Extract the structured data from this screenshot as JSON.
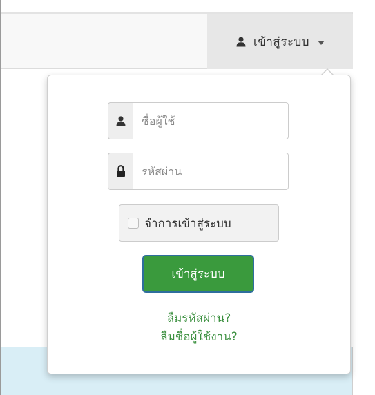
{
  "navbar": {
    "login_toggle_label": "เข้าสู่ระบบ",
    "login_toggle_icon": "user-icon",
    "caret_icon": "caret-down-icon"
  },
  "login_form": {
    "username": {
      "icon": "user-icon",
      "placeholder": "ชื่อผู้ใช้",
      "value": ""
    },
    "password": {
      "icon": "lock-icon",
      "placeholder": "รหัสผ่าน",
      "value": ""
    },
    "remember_me": {
      "label": "จำการเข้าสู่ระบบ",
      "checked": false
    },
    "submit_label": "เข้าสู่ระบบ",
    "forgot_password_label": "ลืมรหัสผ่าน?",
    "forgot_username_label": "ลืมชื่อผู้ใช้งาน?"
  },
  "colors": {
    "submit_bg": "#3a9a3d",
    "submit_border": "#2f6e9d",
    "link": "#3a8f3e",
    "navbar_bg": "#f8f8f8",
    "toggle_active_bg": "#e7e7e7",
    "page_bottom_bg": "#d9eef6"
  }
}
